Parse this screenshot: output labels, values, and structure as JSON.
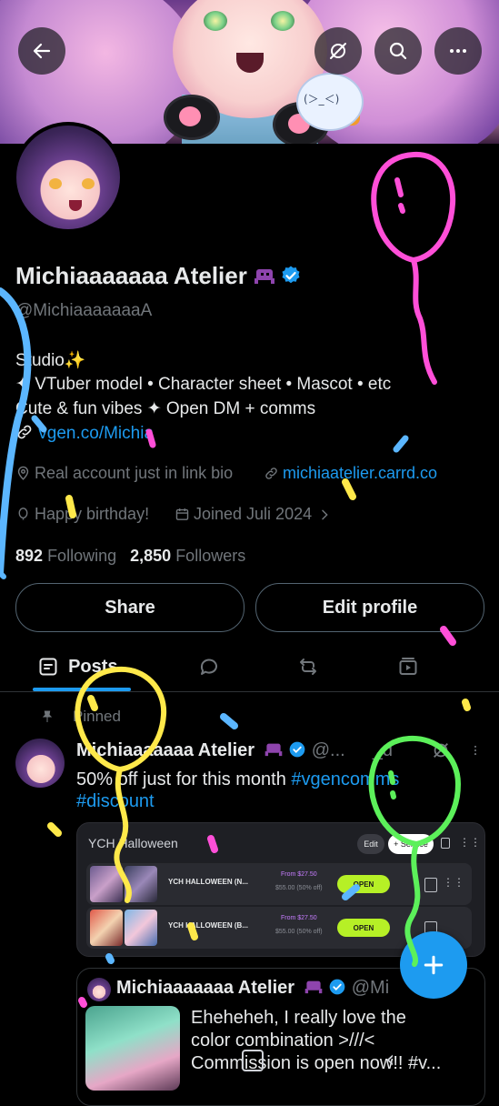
{
  "header": {
    "back_icon": "arrow-left-icon",
    "grok_icon": "grok-icon",
    "search_icon": "search-icon",
    "more_icon": "more-icon"
  },
  "profile": {
    "name": "Michiaaaaaaa Atelier",
    "handle": "@MichiaaaaaaaA",
    "bio_line1": "Studio✨",
    "bio_line2": "✦ VTuber model • Character sheet • Mascot • etc",
    "bio_line3": "Cute & fun vibes ✦ Open DM + comms",
    "bio_link": "vgen.co/Michia",
    "location": "Real account just in link bio",
    "website": "michiaatelier.carrd.co",
    "birthday": "Happy birthday!",
    "joined": "Joined Juli 2024",
    "following_count": "892",
    "following_label": "Following",
    "followers_count": "2,850",
    "followers_label": "Followers"
  },
  "actions": {
    "share_label": "Share",
    "edit_label": "Edit profile"
  },
  "tabs": {
    "posts_label": "Posts",
    "posts_chevron": "⌄"
  },
  "post": {
    "pinned_label": "Pinned",
    "author": "Michiaaaaaaa Atelier",
    "handle": "@...",
    "handle_tail": "_d",
    "line1_plain": "50% off just for this month ",
    "line1_tag": "#vgencomms",
    "line2_tag": "#discount",
    "card": {
      "title": "YCH Halloween",
      "edit_chip": "Edit",
      "service_chip": "+ Service",
      "rows": [
        {
          "label": "YCH HALLOWEEN (N...",
          "from": "From $27.50",
          "old": "$55.00 (50% off)",
          "status": "OPEN"
        },
        {
          "label": "YCH HALLOWEEN (B...",
          "from": "From $27.50",
          "old": "$55.00 (50% off)",
          "status": "OPEN"
        }
      ]
    },
    "quote": {
      "author": "Michiaaaaaaa Atelier",
      "handle": "@Mi",
      "handle_tail": "2d",
      "line1": "Eheheheh, I really love the",
      "line2": "color combination >///<",
      "line3": "Commission is open now!! #v..."
    }
  },
  "fab": {
    "icon": "plus-icon"
  },
  "colors": {
    "accent": "#1d9bf0",
    "muted": "#71767b",
    "background": "#000000",
    "open_badge": "#b6f026"
  }
}
